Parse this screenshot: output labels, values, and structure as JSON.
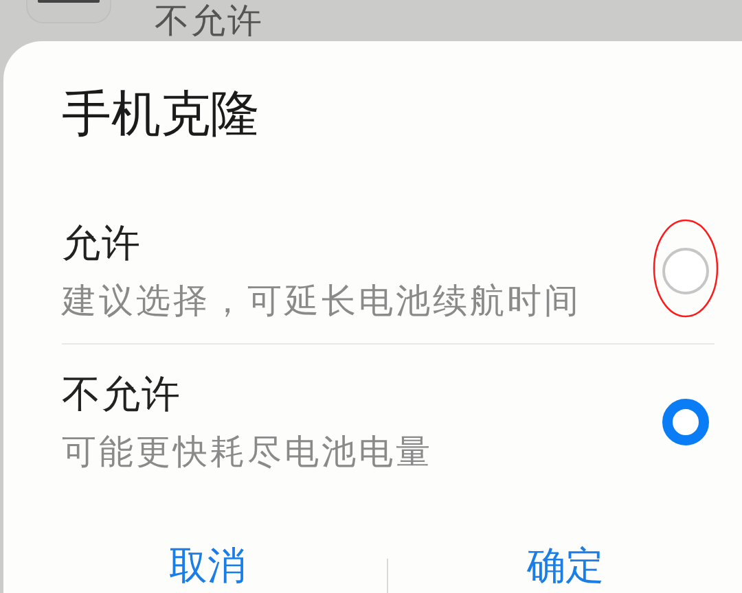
{
  "background": {
    "setting_value": "不允许"
  },
  "dialog": {
    "title": "手机克隆",
    "options": [
      {
        "label": "允许",
        "description": "建议选择，可延长电池续航时间",
        "selected": false,
        "highlighted": true
      },
      {
        "label": "不允许",
        "description": "可能更快耗尽电池电量",
        "selected": true,
        "highlighted": false
      }
    ],
    "buttons": [
      "取消",
      "确定"
    ]
  }
}
